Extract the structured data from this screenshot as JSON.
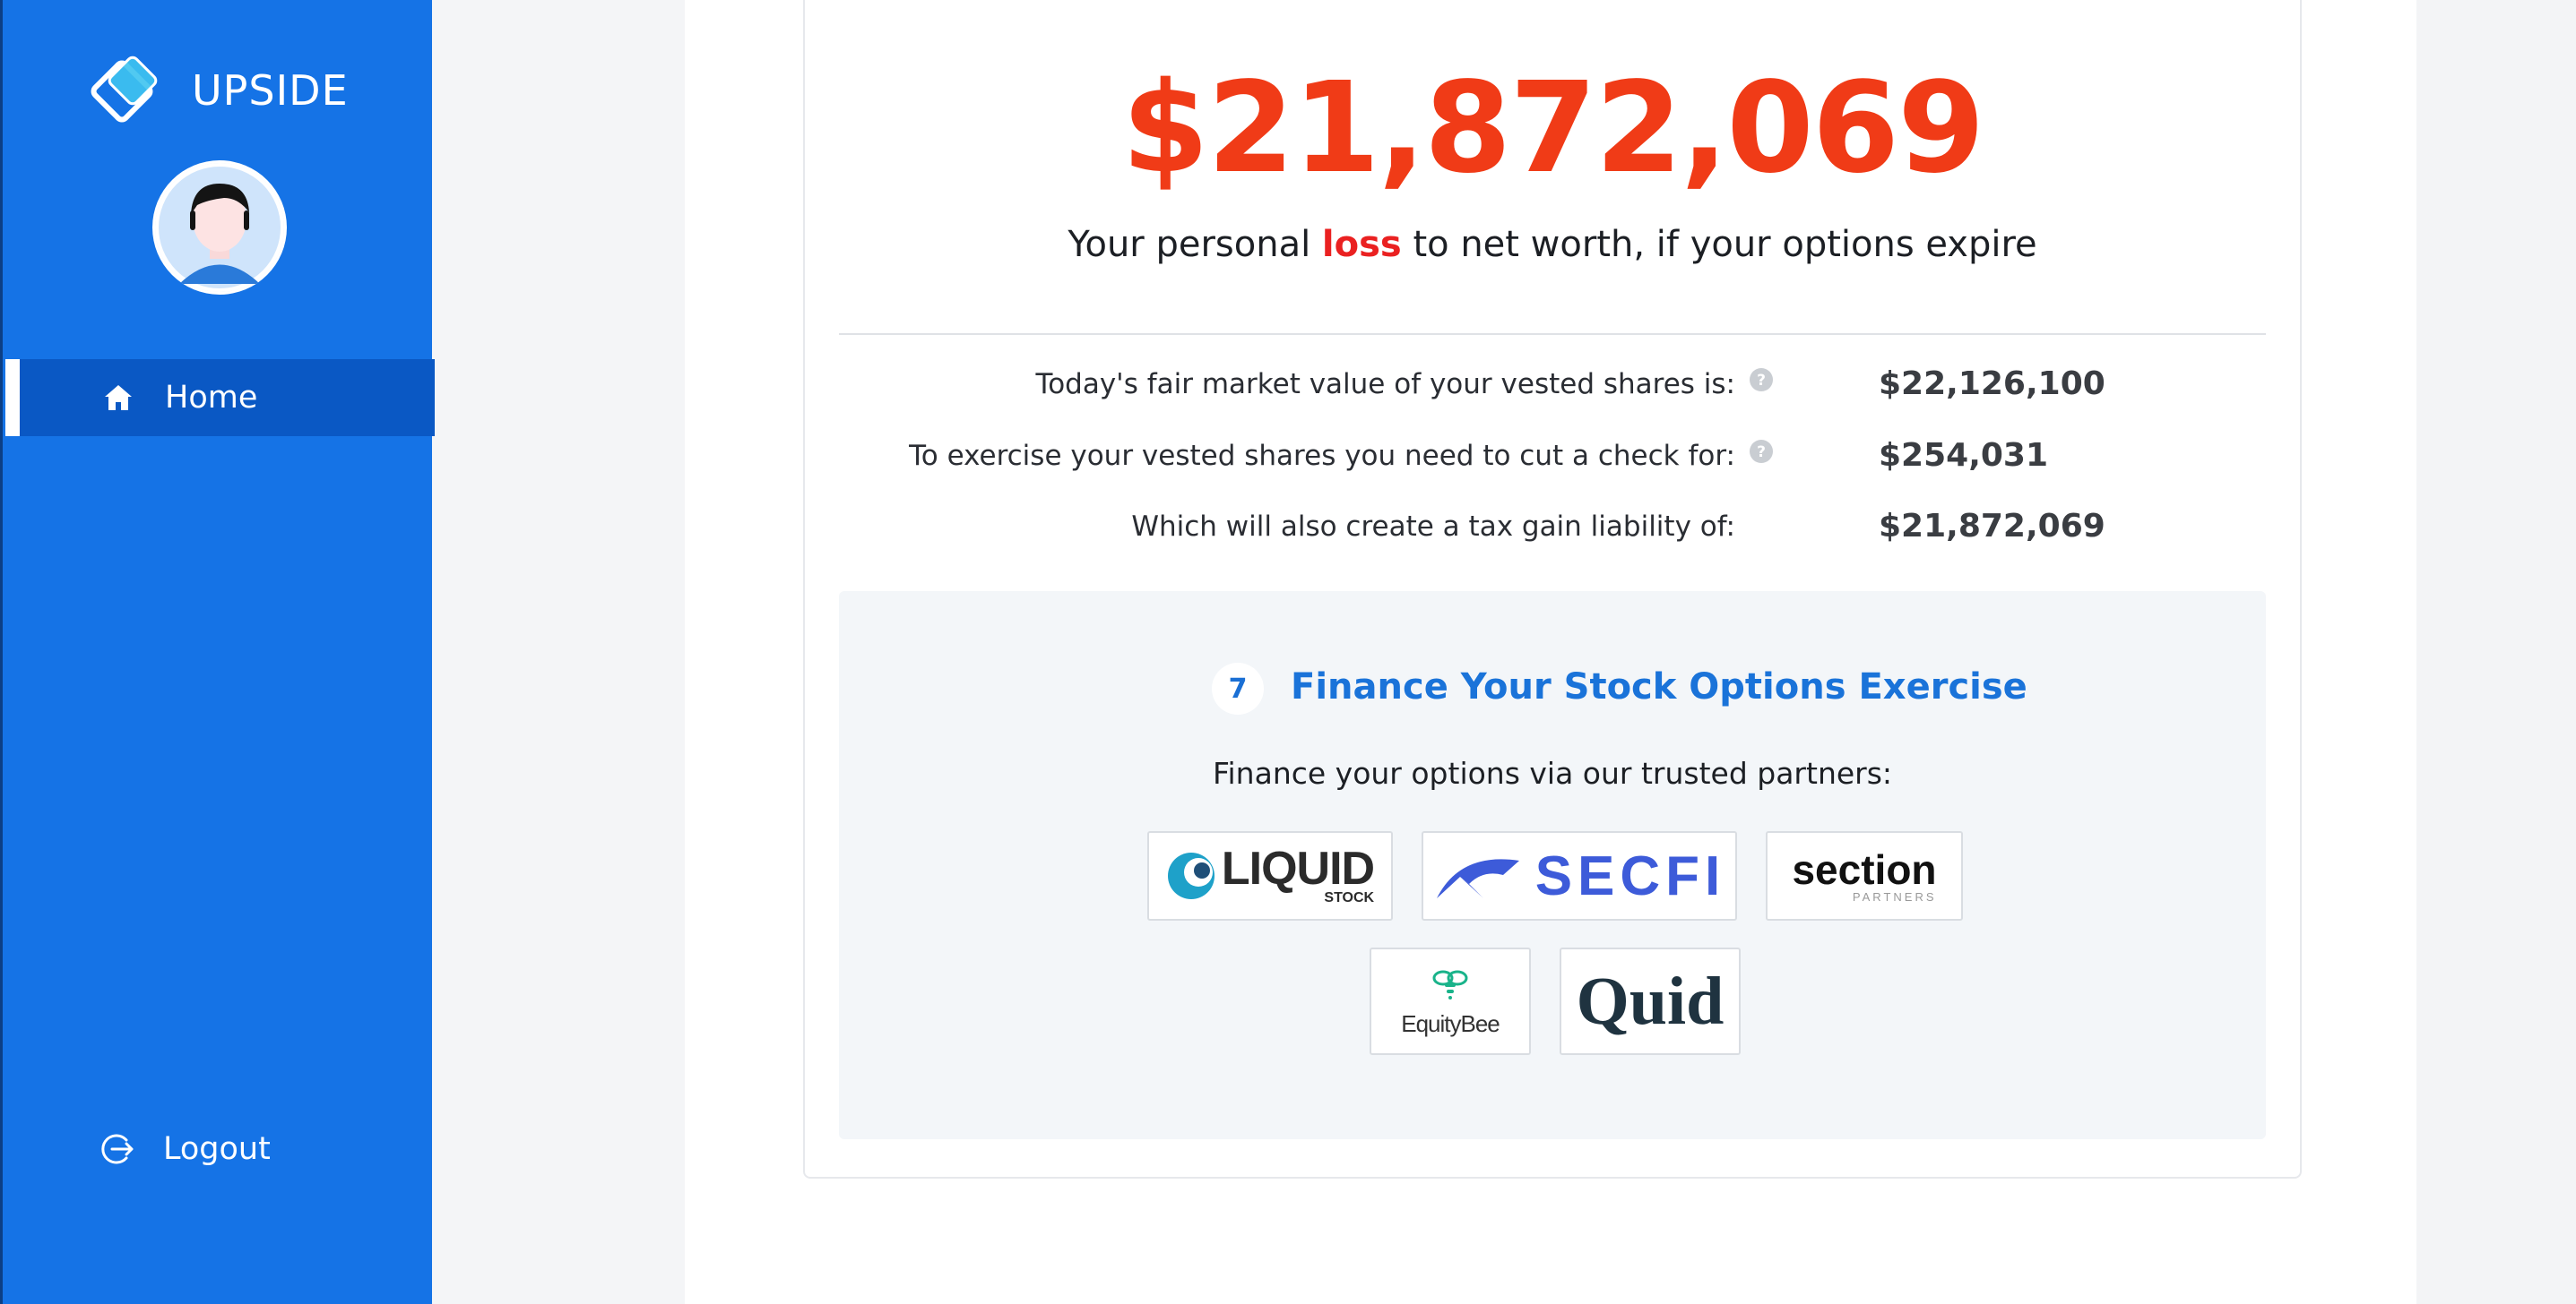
{
  "sidebar": {
    "brand": "UPSIDE",
    "nav": [
      {
        "label": "Home",
        "icon": "home-icon",
        "active": true
      },
      {
        "label": "Logout",
        "icon": "logout-icon"
      }
    ]
  },
  "summary": {
    "loss_amount": "$21,872,069",
    "caption_before": "Your personal ",
    "caption_highlight": "loss",
    "caption_after": " to net worth, if your options expire",
    "rows": [
      {
        "label": "Today's fair market value of your vested shares is:",
        "value": "$22,126,100",
        "help": true
      },
      {
        "label": "To exercise your vested shares you need to cut a check for:",
        "value": "$254,031",
        "help": true
      },
      {
        "label": "Which will also create a tax gain liability of:",
        "value": "$21,872,069",
        "help": false
      }
    ]
  },
  "finance": {
    "step": "7",
    "title": "Finance Your Stock Options Exercise",
    "subtitle": "Finance your options via our trusted partners:",
    "partners": [
      {
        "name": "LIQUID",
        "tagline": "STOCK"
      },
      {
        "name": "SECFI"
      },
      {
        "name": "section",
        "tagline": "PARTNERS"
      },
      {
        "name": "EquityBee"
      },
      {
        "name": "Quid"
      }
    ]
  },
  "colors": {
    "sidebar": "#1573e6",
    "sidebar_active": "#0a58c4",
    "loss": "#f03b17",
    "accent": "#1a73d9"
  }
}
